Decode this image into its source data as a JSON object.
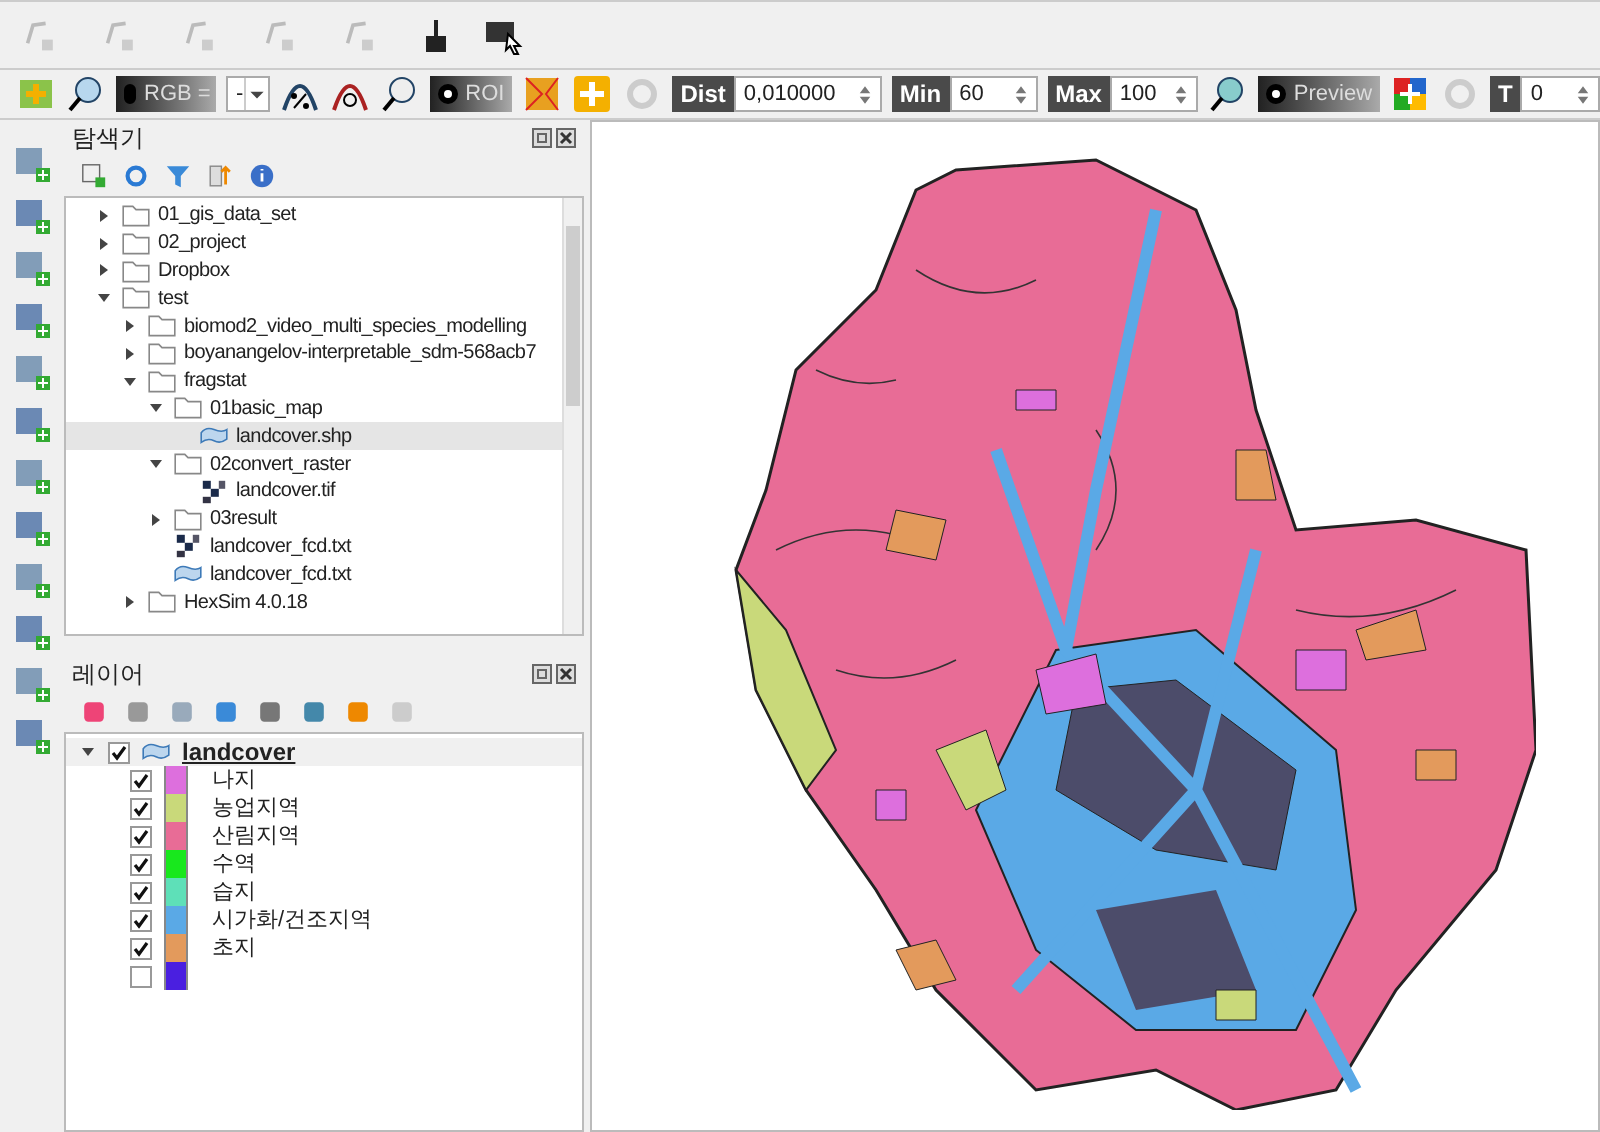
{
  "toolbar": {
    "rgb_label": "RGB =",
    "rgb_combo": "-",
    "roi_label": "ROI",
    "dist": {
      "label": "Dist",
      "value": "0,010000"
    },
    "min": {
      "label": "Min",
      "value": "60"
    },
    "max": {
      "label": "Max",
      "value": "100"
    },
    "preview_label": "Preview",
    "t": {
      "label": "T",
      "value": "0"
    }
  },
  "browser": {
    "title": "탐색기",
    "items": [
      {
        "name": "01_gis_data_set",
        "kind": "folder",
        "expanded": false,
        "selected": false
      },
      {
        "name": "02_project",
        "kind": "folder",
        "expanded": false,
        "selected": false
      },
      {
        "name": "Dropbox",
        "kind": "folder",
        "expanded": false,
        "selected": false
      },
      {
        "name": "test",
        "kind": "folder",
        "expanded": true,
        "selected": false,
        "children": [
          {
            "name": "biomod2_video_multi_species_modelling",
            "kind": "folder",
            "expanded": false,
            "selected": false
          },
          {
            "name": "boyanangelov-interpretable_sdm-568acb7",
            "kind": "folder",
            "expanded": false,
            "selected": false
          },
          {
            "name": "fragstat",
            "kind": "folder",
            "expanded": true,
            "selected": false,
            "children": [
              {
                "name": "01basic_map",
                "kind": "folder",
                "expanded": true,
                "selected": false,
                "children": [
                  {
                    "name": "landcover.shp",
                    "kind": "vector",
                    "selected": true
                  }
                ]
              },
              {
                "name": "02convert_raster",
                "kind": "folder",
                "expanded": true,
                "selected": false,
                "children": [
                  {
                    "name": "landcover.tif",
                    "kind": "raster",
                    "selected": false
                  }
                ]
              },
              {
                "name": "03result",
                "kind": "folder",
                "expanded": false,
                "selected": false
              },
              {
                "name": "landcover_fcd.txt",
                "kind": "raster",
                "selected": false
              },
              {
                "name": "landcover_fcd.txt",
                "kind": "vector",
                "selected": false
              }
            ]
          },
          {
            "name": "HexSim 4.0.18",
            "kind": "folder",
            "expanded": false,
            "selected": false
          }
        ]
      }
    ]
  },
  "layers": {
    "title": "레이어",
    "layer": {
      "name": "landcover",
      "checked": true,
      "expanded": true
    },
    "legend": [
      {
        "label": "나지",
        "checked": true,
        "color": "#dd6fdd"
      },
      {
        "label": "농업지역",
        "checked": true,
        "color": "#c9d97a"
      },
      {
        "label": "산림지역",
        "checked": true,
        "color": "#e86c96"
      },
      {
        "label": "수역",
        "checked": true,
        "color": "#18e81d"
      },
      {
        "label": "습지",
        "checked": true,
        "color": "#5ee0b8"
      },
      {
        "label": "시가화/건조지역",
        "checked": true,
        "color": "#5aa9e6"
      },
      {
        "label": "초지",
        "checked": true,
        "color": "#e39a5c"
      },
      {
        "checked": false,
        "color": "#4a1fe0"
      }
    ]
  }
}
